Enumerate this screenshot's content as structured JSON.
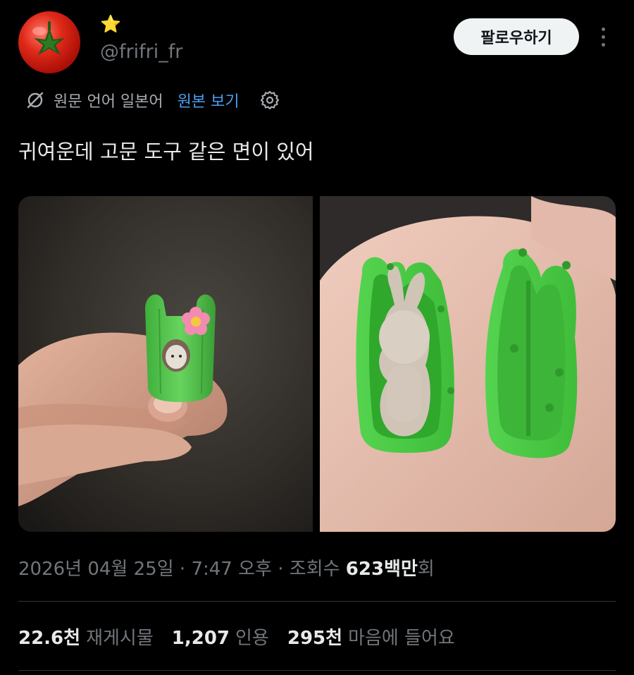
{
  "author": {
    "display_name": "⭐",
    "handle": "@frifri_fr",
    "avatar_icon": "tomato-icon"
  },
  "actions": {
    "follow_label": "팔로우하기",
    "more_icon": "more-vertical-icon"
  },
  "translation": {
    "icon": "translate-off-icon",
    "language_note": "원문 언어 일본어",
    "view_original_label": "원본 보기",
    "settings_icon": "gear-icon"
  },
  "tweet": {
    "text": "귀여운데 고문 도구 같은 면이 있어"
  },
  "media": {
    "photo_count": 2
  },
  "meta": {
    "date": "2026년 04월 25일",
    "time": "7:47 오후",
    "separator": "·",
    "views_prefix": "조회수",
    "views_count": "623백만",
    "views_suffix": "회"
  },
  "stats": [
    {
      "count": "22.6천",
      "label": "재게시물"
    },
    {
      "count": "1,207",
      "label": "인용"
    },
    {
      "count": "295천",
      "label": "마음에 들어요"
    }
  ],
  "colors": {
    "background": "#000000",
    "link": "#4a9ff2",
    "muted": "#71767b",
    "text": "#e7e9ea",
    "follow_bg": "#eff3f4"
  }
}
